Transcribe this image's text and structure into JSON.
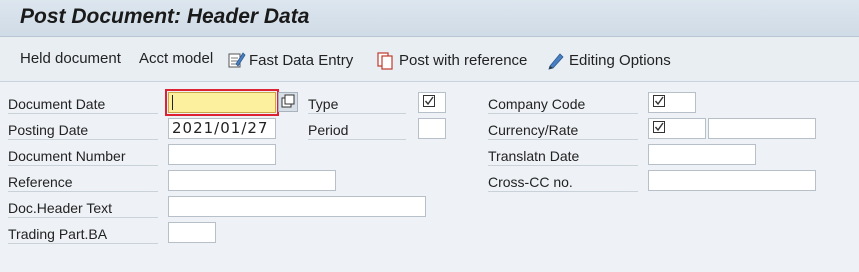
{
  "window": {
    "title": "Post Document: Header Data"
  },
  "toolbar": {
    "held_document": "Held document",
    "acct_model": "Acct model",
    "fast_data_entry": "Fast Data Entry",
    "post_with_reference": "Post with reference",
    "editing_options": "Editing Options"
  },
  "form": {
    "document_date": {
      "label": "Document Date",
      "value": ""
    },
    "posting_date": {
      "label": "Posting Date",
      "value": "2021/01/27"
    },
    "document_number": {
      "label": "Document Number",
      "value": ""
    },
    "reference": {
      "label": "Reference",
      "value": ""
    },
    "doc_header_text": {
      "label": "Doc.Header Text",
      "value": ""
    },
    "trading_part_ba": {
      "label": "Trading Part.BA",
      "value": ""
    },
    "type": {
      "label": "Type",
      "value": "☑"
    },
    "period": {
      "label": "Period",
      "value": ""
    },
    "company_code": {
      "label": "Company Code",
      "value": "☑"
    },
    "currency_rate": {
      "label": "Currency/Rate",
      "currency": "☑",
      "rate": ""
    },
    "translatn_date": {
      "label": "Translatn Date",
      "value": ""
    },
    "cross_cc_no": {
      "label": "Cross-CC no.",
      "value": ""
    }
  },
  "colors": {
    "title_bar": "#d6e0ea",
    "toolbar": "#e9eef3",
    "active_field": "#fcef9e",
    "focus_outline": "#dd2233"
  },
  "icons": [
    "fast-data-entry-icon",
    "post-with-reference-icon",
    "editing-options-icon",
    "value-help-icon",
    "checkbox-icon"
  ]
}
